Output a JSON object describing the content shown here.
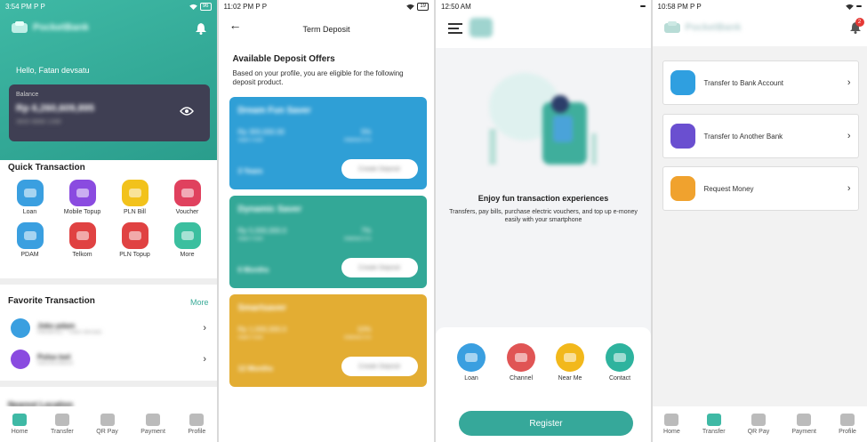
{
  "screens": {
    "home": {
      "status": {
        "time": "3:54 PM",
        "indicators": "P P",
        "battery": "96"
      },
      "brand": "PocketBank",
      "greeting": "Hello, Fatan devsatu",
      "balance": {
        "label": "Balance",
        "amount": "Rp 6,260,609,895",
        "account": "3600 8888 1398"
      },
      "quick_title": "Quick Transaction",
      "quick_items": [
        {
          "label": "Loan",
          "color": "#3a9fe0"
        },
        {
          "label": "Mobile Topup",
          "color": "#8a4be0"
        },
        {
          "label": "PLN Bill",
          "color": "#f2c21b"
        },
        {
          "label": "Voucher",
          "color": "#e0415e"
        },
        {
          "label": "PDAM",
          "color": "#3a9fe0"
        },
        {
          "label": "Telkom",
          "color": "#e04242"
        },
        {
          "label": "PLN Topup",
          "color": "#e04242"
        },
        {
          "label": "More",
          "color": "#3bbf9f"
        }
      ],
      "favorite_title": "Favorite Transaction",
      "favorite_more": "More",
      "favorites": [
        {
          "name": "Joko pdam",
          "sub": "446380111 · Fatan devsatu",
          "color": "#3a9fe0"
        },
        {
          "name": "Pulsa tsel",
          "sub": "085205148554",
          "color": "#8a4be0"
        }
      ],
      "section_cut": "Nearest Location"
    },
    "deposit": {
      "status": {
        "time": "11:02 PM",
        "indicators": "P P",
        "battery": "19"
      },
      "title": "Term Deposit",
      "heading": "Available Deposit Offers",
      "subtext": "Based on your profile, you are eligible for the following deposit product.",
      "offers": [
        {
          "name": "Dream Fun Saver",
          "amount": "Rp 300,000.00",
          "amount_label": "Start From",
          "rate": "5%",
          "rate_label": "Interest P.A",
          "tenor": "3 Years",
          "cta": "Create Deposit",
          "color": "#2f9fd6"
        },
        {
          "name": "Dynamic Saver",
          "amount": "Rp 5,000,000.0",
          "amount_label": "Start From",
          "rate": "7%",
          "rate_label": "Interest P.A",
          "tenor": "6 Months",
          "cta": "Create Deposit",
          "color": "#33a897"
        },
        {
          "name": "Smartsaver",
          "amount": "Rp 1,000,000.0",
          "amount_label": "Start From",
          "rate": "10%",
          "rate_label": "Interest P.A",
          "tenor": "12 Months",
          "cta": "Create Deposit",
          "color": "#e3ad33"
        }
      ]
    },
    "welcome": {
      "status": {
        "time": "12:50 AM",
        "battery": ""
      },
      "headline": "Enjoy fun transaction experiences",
      "description": "Transfers, pay bills, purchase electric vouchers, and top up e-money easily with your smartphone",
      "channels": [
        {
          "label": "Loan",
          "color": "#3a9fe0"
        },
        {
          "label": "Channel",
          "color": "#e05555"
        },
        {
          "label": "Near Me",
          "color": "#f2b81b"
        },
        {
          "label": "Contact",
          "color": "#2eb39e"
        }
      ],
      "register": "Register"
    },
    "transfer": {
      "status": {
        "time": "10:58 PM",
        "indicators": "P P",
        "battery": ""
      },
      "brand": "PocketBank",
      "notif_count": "2",
      "options": [
        {
          "label": "Transfer to Bank Account",
          "color": "#2f9fe0"
        },
        {
          "label": "Transfer to Another Bank",
          "color": "#6a4fd0"
        },
        {
          "label": "Request Money",
          "color": "#f0a22e"
        }
      ]
    }
  },
  "nav": [
    {
      "label": "Home"
    },
    {
      "label": "Transfer"
    },
    {
      "label": "QR Pay"
    },
    {
      "label": "Payment"
    },
    {
      "label": "Profile"
    }
  ]
}
